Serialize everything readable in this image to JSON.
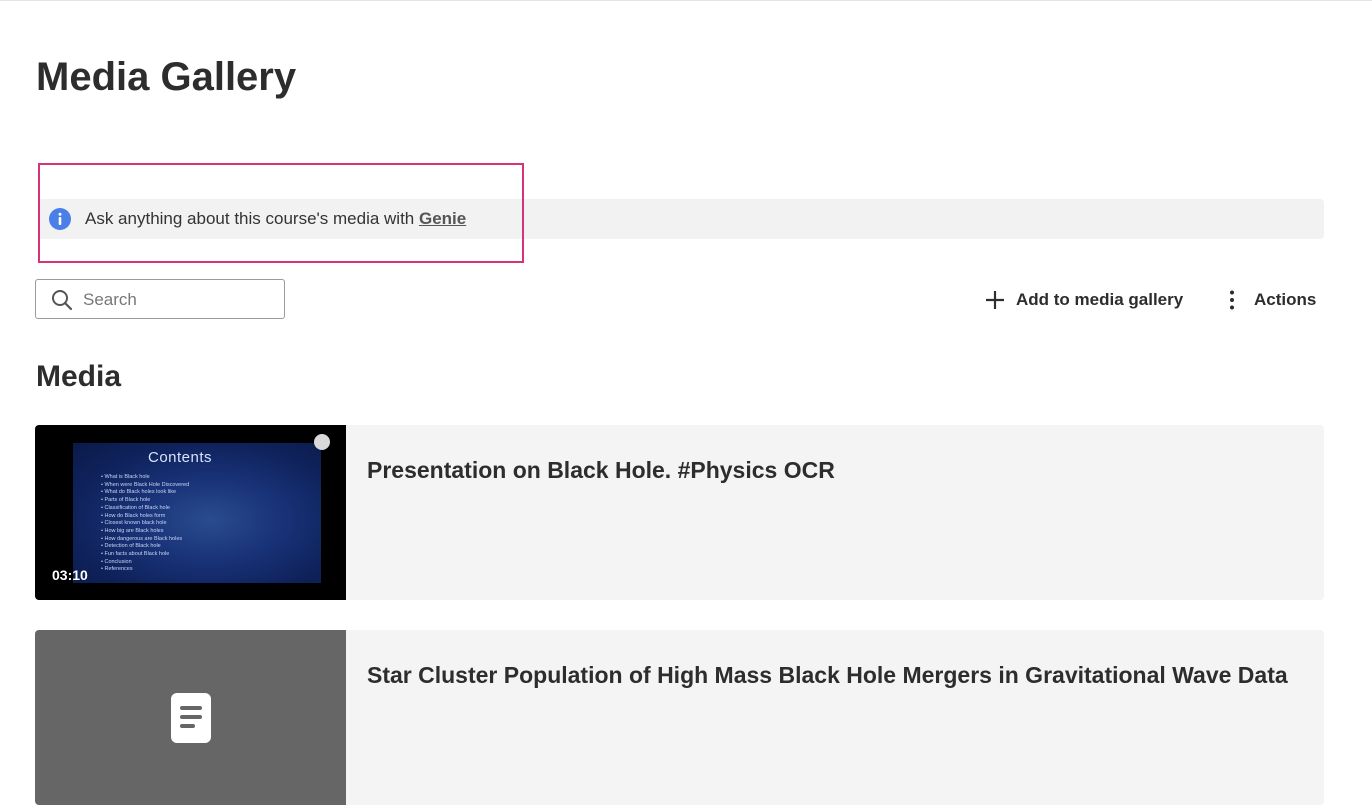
{
  "page": {
    "title": "Media Gallery"
  },
  "banner": {
    "text": "Ask anything about this course's media with ",
    "link_label": "Genie",
    "icon": "info-icon",
    "accent": "#4a7ee8",
    "highlight_color": "#d6327a"
  },
  "search": {
    "placeholder": "Search",
    "value": ""
  },
  "toolbar": {
    "add_label": "Add to media gallery",
    "actions_label": "Actions"
  },
  "section": {
    "title": "Media"
  },
  "media_items": [
    {
      "title": "Presentation on Black Hole. #Physics OCR",
      "type": "video",
      "duration": "03:10",
      "thumbnail": {
        "heading": "Contents",
        "items": [
          "What is Black hole",
          "When were Black Hole Discovered",
          "What do Black holes look like",
          "Parts of Black hole",
          "Classification of Black hole",
          "How do Black holes form",
          "Closest known black hole",
          "How big are Black holes",
          "How dangerous are Black holes",
          "Detection of Black hole",
          "Fun facts about Black hole",
          "Conclusion",
          "References"
        ]
      }
    },
    {
      "title": "Star Cluster Population of High Mass Black Hole Mergers in Gravitational Wave Data",
      "type": "document",
      "icon": "document-icon"
    }
  ]
}
